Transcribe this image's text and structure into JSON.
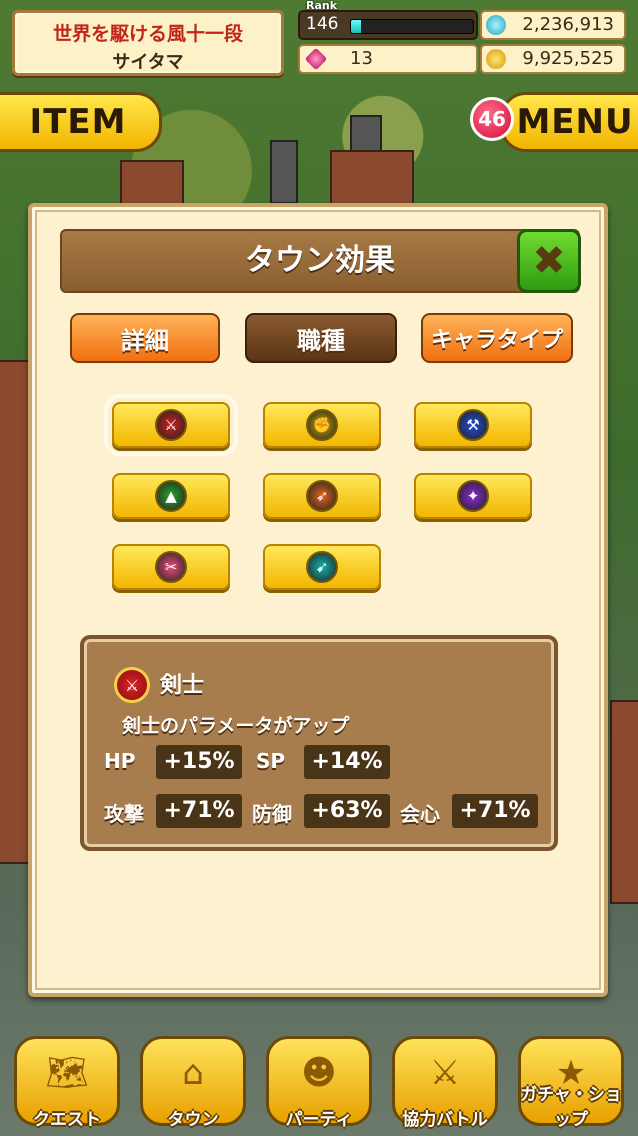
{
  "header": {
    "title_line1": "世界を駆ける風十一段",
    "title_line2": "サイタマ",
    "rank_label": "Rank",
    "rank_value": "146",
    "rank_progress": 0.08,
    "stamina": "2,236,913",
    "gems": "13",
    "coins": "9,925,525"
  },
  "top_buttons": {
    "item_label": "ITEM",
    "menu_label": "MENU",
    "menu_badge": "46"
  },
  "dialog": {
    "title": "タウン効果",
    "tabs": [
      {
        "label": "詳細",
        "active": false
      },
      {
        "label": "職種",
        "active": true
      },
      {
        "label": "キャラタイプ",
        "active": false
      }
    ],
    "jobs": [
      {
        "icon": "sword-emblem-icon",
        "color": "#d32020",
        "selected": true
      },
      {
        "icon": "fist-emblem-icon",
        "color": "#c9a300",
        "selected": false
      },
      {
        "icon": "axe-emblem-icon",
        "color": "#1f4fd8",
        "selected": false
      },
      {
        "icon": "spear-emblem-icon",
        "color": "#2aa52a",
        "selected": false
      },
      {
        "icon": "bow-emblem-icon",
        "color": "#e0641a",
        "selected": false
      },
      {
        "icon": "staff-emblem-icon",
        "color": "#8a2ad0",
        "selected": false
      },
      {
        "icon": "dagger-emblem-icon",
        "color": "#e84c7a",
        "selected": false
      },
      {
        "icon": "wing-emblem-icon",
        "color": "#16b0a8",
        "selected": false
      }
    ],
    "info": {
      "job_name": "剣士",
      "description": "剣士のパラメータがアップ",
      "stats": [
        {
          "label": "HP",
          "value": "+15%"
        },
        {
          "label": "SP",
          "value": "+14%"
        },
        {
          "label": "攻撃",
          "value": "+71%"
        },
        {
          "label": "防御",
          "value": "+63%"
        },
        {
          "label": "会心",
          "value": "+71%"
        }
      ]
    }
  },
  "bottom_nav": [
    {
      "label": "クエスト",
      "icon": "quest-map-icon"
    },
    {
      "label": "タウン",
      "icon": "town-icon"
    },
    {
      "label": "パーティ",
      "icon": "party-icon"
    },
    {
      "label": "協力バトル",
      "icon": "coop-battle-icon"
    },
    {
      "label": "ガチャ・ショップ",
      "icon": "gacha-star-icon"
    }
  ]
}
